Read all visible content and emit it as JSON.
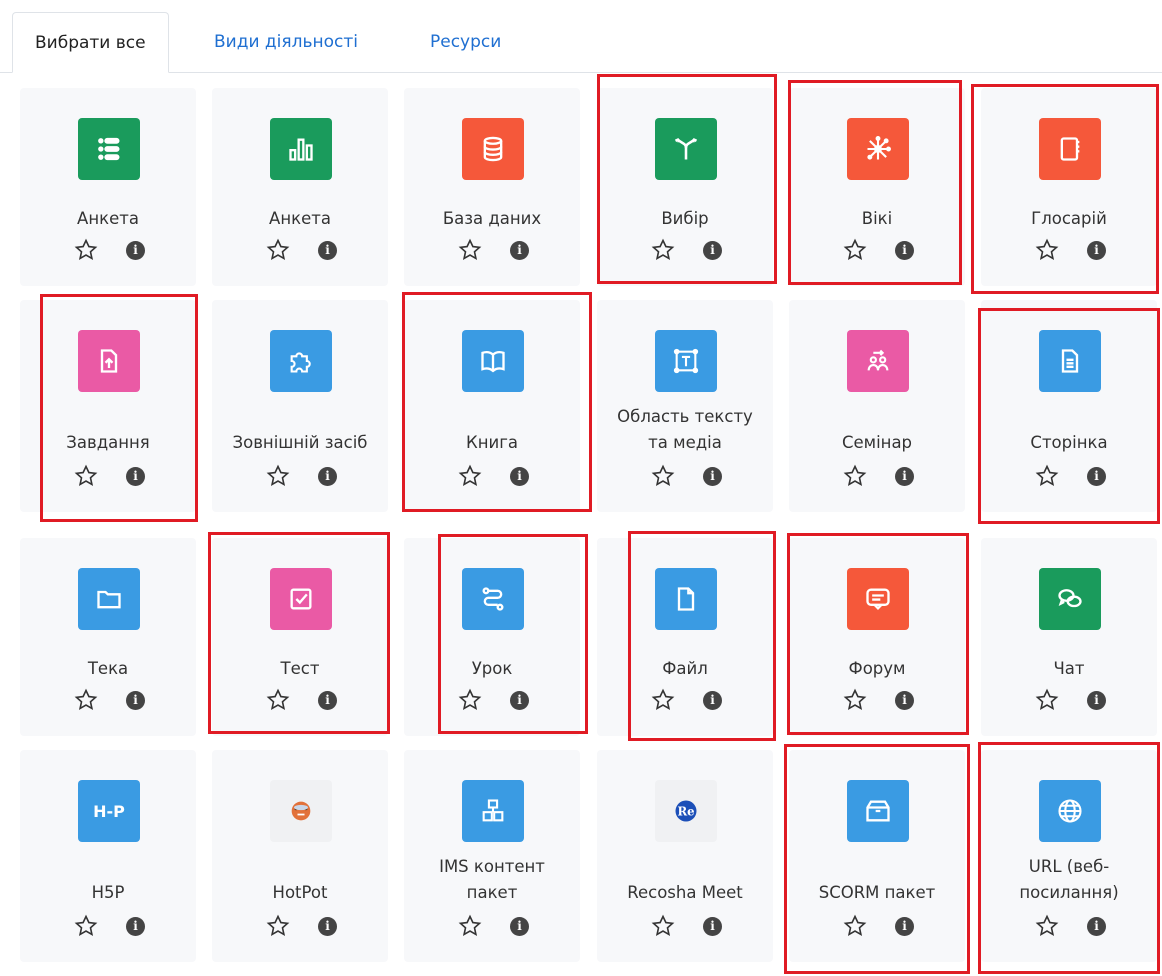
{
  "tabs": [
    {
      "label": "Вибрати все",
      "active": true
    },
    {
      "label": "Види діяльності",
      "active": false
    },
    {
      "label": "Ресурси",
      "active": false
    }
  ],
  "items": [
    {
      "label": "Анкета",
      "icon": "feedback-icon",
      "color": "#1a9b5c",
      "highlighted": false
    },
    {
      "label": "Анкета",
      "icon": "survey-chart-icon",
      "color": "#1a9b5c",
      "highlighted": false
    },
    {
      "label": "База даних",
      "icon": "database-icon",
      "color": "#f5583a",
      "highlighted": false
    },
    {
      "label": "Вибір",
      "icon": "choice-fork-icon",
      "color": "#1a9b5c",
      "highlighted": true
    },
    {
      "label": "Вікі",
      "icon": "wiki-network-icon",
      "color": "#f5583a",
      "highlighted": true
    },
    {
      "label": "Глосарій",
      "icon": "glossary-book-icon",
      "color": "#f5583a",
      "highlighted": true
    },
    {
      "label": "Завдання",
      "icon": "assignment-upload-icon",
      "color": "#ea5aa5",
      "highlighted": true
    },
    {
      "label": "Зовнішній засіб",
      "icon": "puzzle-icon",
      "color": "#3a9be3",
      "highlighted": false
    },
    {
      "label": "Книга",
      "icon": "book-open-icon",
      "color": "#3a9be3",
      "highlighted": true
    },
    {
      "label_line1": "Область тексту",
      "label_line2": "та медіа",
      "icon": "text-area-icon",
      "color": "#3a9be3",
      "highlighted": false
    },
    {
      "label": "Семінар",
      "icon": "workshop-people-icon",
      "color": "#ea5aa5",
      "highlighted": false
    },
    {
      "label": "Сторінка",
      "icon": "page-document-icon",
      "color": "#3a9be3",
      "highlighted": true
    },
    {
      "label": "Тека",
      "icon": "folder-icon",
      "color": "#3a9be3",
      "highlighted": false
    },
    {
      "label": "Тест",
      "icon": "quiz-checkbox-icon",
      "color": "#ea5aa5",
      "highlighted": true
    },
    {
      "label": "Урок",
      "icon": "lesson-path-icon",
      "color": "#3a9be3",
      "highlighted": true
    },
    {
      "label": "Файл",
      "icon": "file-icon",
      "color": "#3a9be3",
      "highlighted": true
    },
    {
      "label": "Форум",
      "icon": "forum-message-icon",
      "color": "#f5583a",
      "highlighted": true
    },
    {
      "label": "Чат",
      "icon": "chat-bubbles-icon",
      "color": "#1a9b5c",
      "highlighted": false
    },
    {
      "label": "H5P",
      "icon": "h5p-icon",
      "icon_text": "H-P",
      "color": "#3a9be3",
      "highlighted": false
    },
    {
      "label": "HotPot",
      "icon": "hotpot-icon",
      "color": "#f0f1f3",
      "highlighted": false
    },
    {
      "label_line1": "IMS контент",
      "label_line2": "пакет",
      "icon": "ims-package-icon",
      "color": "#3a9be3",
      "highlighted": false
    },
    {
      "label": "Recosha Meet",
      "icon": "recosha-logo-icon",
      "icon_text": "Re",
      "color": "#f0f1f3",
      "highlighted": false
    },
    {
      "label": "SCORM пакет",
      "icon": "scorm-box-icon",
      "color": "#3a9be3",
      "highlighted": true
    },
    {
      "label_line1": "URL (веб-",
      "label_line2": "посилання)",
      "icon": "globe-icon",
      "color": "#3a9be3",
      "highlighted": true
    }
  ],
  "info_glyph": "i"
}
